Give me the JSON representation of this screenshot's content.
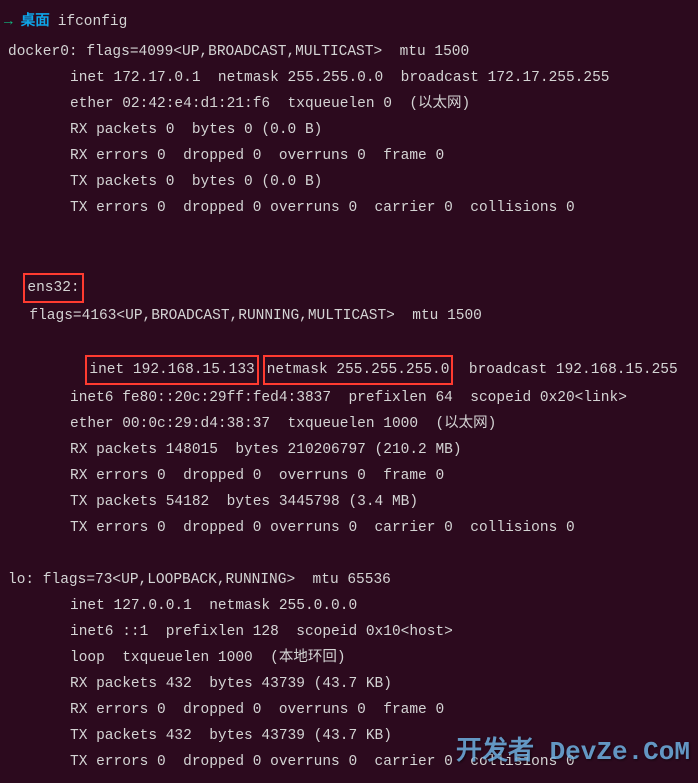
{
  "prompt": {
    "arrow": "→",
    "dir": "桌面",
    "cmd": "ifconfig"
  },
  "docker0": {
    "header": "docker0: flags=4099<UP,BROADCAST,MULTICAST>  mtu 1500",
    "inet": "inet 172.17.0.1  netmask 255.255.0.0  broadcast 172.17.255.255",
    "ether": "ether 02:42:e4:d1:21:f6  txqueuelen 0  (以太网)",
    "rxp": "RX packets 0  bytes 0 (0.0 B)",
    "rxe": "RX errors 0  dropped 0  overruns 0  frame 0",
    "txp": "TX packets 0  bytes 0 (0.0 B)",
    "txe": "TX errors 0  dropped 0 overruns 0  carrier 0  collisions 0"
  },
  "ens32": {
    "name": "ens32:",
    "flags": "flags=4163<UP,BROADCAST,RUNNING,MULTICAST>  mtu 1500",
    "inet": "inet 192.168.15.133",
    "netmask": "netmask 255.255.255.0",
    "broadcast": "  broadcast 192.168.15.255",
    "inet6": "inet6 fe80::20c:29ff:fed4:3837  prefixlen 64  scopeid 0x20<link>",
    "ether": "ether 00:0c:29:d4:38:37  txqueuelen 1000  (以太网)",
    "rxp": "RX packets 148015  bytes 210206797 (210.2 MB)",
    "rxe": "RX errors 0  dropped 0  overruns 0  frame 0",
    "txp": "TX packets 54182  bytes 3445798 (3.4 MB)",
    "txe": "TX errors 0  dropped 0 overruns 0  carrier 0  collisions 0"
  },
  "lo": {
    "header": "lo: flags=73<UP,LOOPBACK,RUNNING>  mtu 65536",
    "inet": "inet 127.0.0.1  netmask 255.0.0.0",
    "inet6": "inet6 ::1  prefixlen 128  scopeid 0x10<host>",
    "loop": "loop  txqueuelen 1000  (本地环回)",
    "rxp": "RX packets 432  bytes 43739 (43.7 KB)",
    "rxe": "RX errors 0  dropped 0  overruns 0  frame 0",
    "txp": "TX packets 432  bytes 43739 (43.7 KB)",
    "txe": "TX errors 0  dropped 0 overruns 0  carrier 0  collisions 0"
  },
  "watermark": "开发者 DevZe.CoM"
}
